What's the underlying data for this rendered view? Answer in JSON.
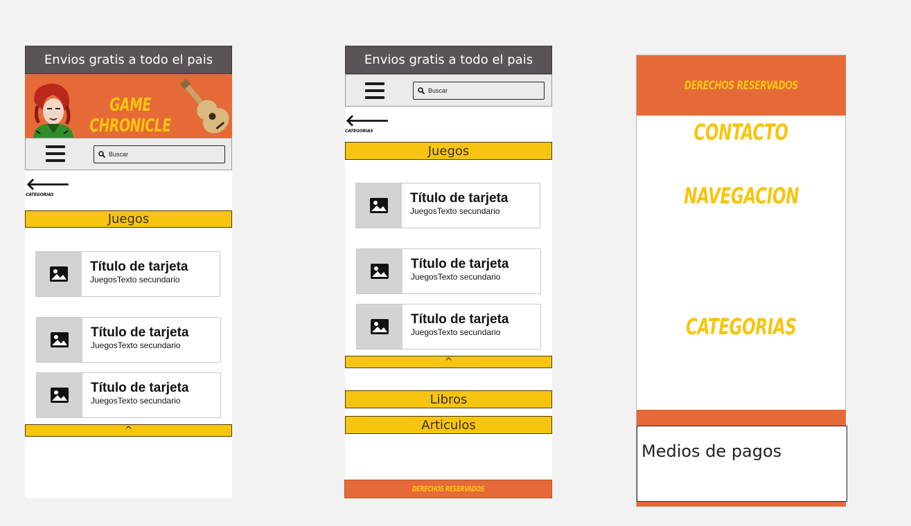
{
  "promo": {
    "text": "Envios gratis a todo el pais"
  },
  "header": {
    "brand": "GAME CHRONICLE"
  },
  "search": {
    "placeholder": "Buscar"
  },
  "back": {
    "label": "CATEGORIAS"
  },
  "section": {
    "title": "Juegos"
  },
  "cards": [
    {
      "title": "Título de tarjeta",
      "subtitle": "JuegosTexto secundario"
    },
    {
      "title": "Título de tarjeta",
      "subtitle": "JuegosTexto secundario"
    },
    {
      "title": "Título de tarjeta",
      "subtitle": "JuegosTexto secundario"
    }
  ],
  "collapse": {
    "label": "^"
  },
  "sections_more": {
    "books": "Libros",
    "articles": "Articulos"
  },
  "footer": {
    "rights": "DERECHOS RESERVADOS",
    "contact": "CONTACTO",
    "navigation": "NAVEGACION",
    "categories": "CATEGORIAS",
    "payments": "Medios de pagos"
  },
  "colors": {
    "accent_orange": "#e56a38",
    "accent_yellow": "#f7c510",
    "topbar": "#5a5358"
  },
  "icons": {
    "search": "magnifier-icon",
    "menu": "hamburger-icon",
    "back": "arrow-left-icon",
    "image": "image-placeholder-icon"
  }
}
